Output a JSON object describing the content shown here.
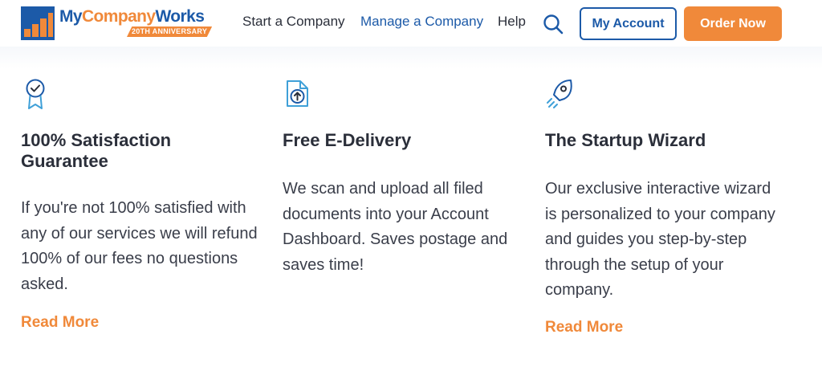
{
  "logo": {
    "my": "My",
    "company": "Company",
    "works": "Works",
    "badge": "20TH ANNIVERSARY",
    "icon": "bar-chart-logo-icon"
  },
  "nav": {
    "start": "Start a Company",
    "manage": "Manage a Company",
    "help": "Help",
    "search_icon": "search-icon"
  },
  "buttons": {
    "account": "My Account",
    "order": "Order Now"
  },
  "features": [
    {
      "icon": "award-ribbon-check-icon",
      "title": "100% Satisfaction Guarantee",
      "body": "If you're not 100% satisfied with any of our services we will refund 100% of our fees no questions asked.",
      "link": "Read More"
    },
    {
      "icon": "document-upload-icon",
      "title": "Free E-Delivery",
      "body": "We scan and upload all filed documents into your Account Dashboard. Saves postage and saves time!"
    },
    {
      "icon": "rocket-icon",
      "title": "The Startup Wizard",
      "body": "Our exclusive interactive wizard is personalized to your company and guides you step-by-step through the setup of your company.",
      "link": "Read More"
    }
  ],
  "colors": {
    "brand_blue": "#1c5aa8",
    "brand_orange": "#f0893a",
    "text_dark": "#2b2f3a"
  }
}
